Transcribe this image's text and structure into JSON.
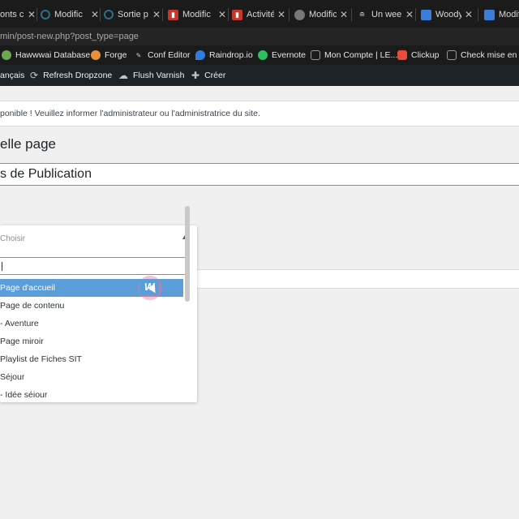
{
  "browser": {
    "tabs": [
      {
        "label": "onts c",
        "icon": "wp-icon",
        "color": "#3a3a3a"
      },
      {
        "label": "Modific",
        "icon": "loading-icon",
        "color": "#2b6f8a"
      },
      {
        "label": "Sortie p",
        "icon": "loading-icon",
        "color": "#2b6f8a"
      },
      {
        "label": "Modific",
        "icon": "tools-icon",
        "color": "#c0392b"
      },
      {
        "label": "Activité",
        "icon": "tools-icon",
        "color": "#c0392b"
      },
      {
        "label": "Modific",
        "icon": "globe-icon",
        "color": "#777777"
      },
      {
        "label": "Un wee",
        "icon": "burger-icon",
        "color": "#555555"
      },
      {
        "label": "Woody",
        "icon": "doc-icon",
        "color": "#3b7dd8"
      },
      {
        "label": "Modifi",
        "icon": "doc-icon",
        "color": "#3b7dd8"
      }
    ],
    "url": "min/post-new.php?post_type=page",
    "bookmarks": [
      {
        "label": "Hawwwai Database",
        "icon": "hawwwai-icon",
        "color": "#6aa84f"
      },
      {
        "label": "Forge",
        "icon": "forge-icon",
        "color": "#e69138"
      },
      {
        "label": "Conf Editor",
        "icon": "pen-icon",
        "color": "#999999"
      },
      {
        "label": "Raindrop.io",
        "icon": "raindrop-icon",
        "color": "#2f7de1"
      },
      {
        "label": "Evernote",
        "icon": "evernote-icon",
        "color": "#2dbe60"
      },
      {
        "label": "Mon Compte | LE...",
        "icon": "box-icon",
        "color": "#444444"
      },
      {
        "label": "Clickup",
        "icon": "clickup-icon",
        "color": "#e84c3d"
      },
      {
        "label": "Check mise en lig",
        "icon": "folder-icon",
        "color": "#666666"
      }
    ]
  },
  "admin_bar": {
    "items": [
      {
        "label": "ançais",
        "icon": ""
      },
      {
        "label": "Refresh Dropzone",
        "icon": "refresh-icon"
      },
      {
        "label": "Flush Varnish",
        "icon": "cloud-icon"
      },
      {
        "label": "Créer",
        "icon": "plus-icon"
      }
    ]
  },
  "notice": {
    "text": "ponible ! Veuillez informer l'administrateur ou l'administratrice du site."
  },
  "page": {
    "title": "elle page",
    "title_input_value": "s de Publication"
  },
  "dropdown": {
    "placeholder": "Choisir",
    "search_value": "",
    "options": [
      {
        "label": "Page d'accueil",
        "selected": true
      },
      {
        "label": "Page de contenu",
        "selected": false
      },
      {
        "label": "- Aventure",
        "selected": false
      },
      {
        "label": "Page miroir",
        "selected": false
      },
      {
        "label": "Playlist de Fiches SIT",
        "selected": false
      },
      {
        "label": "Séjour",
        "selected": false
      },
      {
        "label": "- Idée séjour",
        "selected": false
      }
    ]
  },
  "cursor_overlay": {
    "logo_text": "W"
  },
  "colors": {
    "selected_option": "#5b9dd9",
    "admin_bar": "#1d2327",
    "content_bg": "#f0f0f1"
  }
}
